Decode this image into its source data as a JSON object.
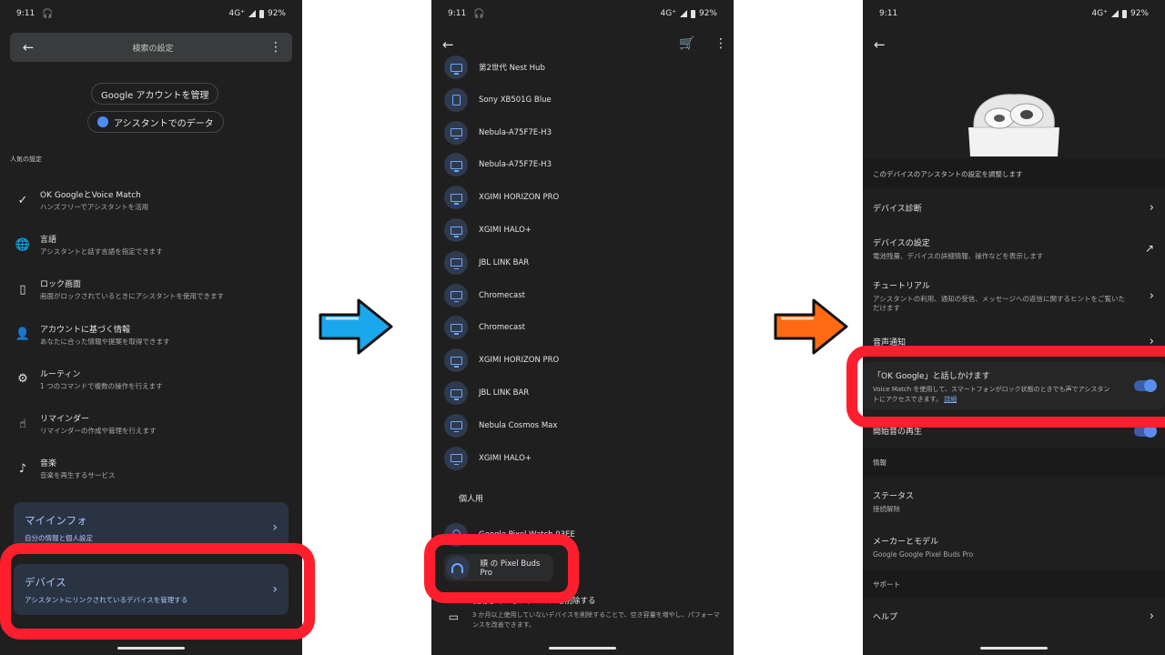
{
  "status": {
    "time": "9:11",
    "network": "4G⁺",
    "battery": "92%"
  },
  "screen1": {
    "title": "検索の設定",
    "chip_account": "Google アカウントを管理",
    "chip_data": "アシスタントでのデータ",
    "section_popular": "人気の設定",
    "items": [
      {
        "title": "OK GoogleとVoice Match",
        "subtitle": "ハンズフリーでアシスタントを活用",
        "icon": "voice-check-icon"
      },
      {
        "title": "言語",
        "subtitle": "アシスタントと話す言語を指定できます",
        "icon": "globe-icon"
      },
      {
        "title": "ロック画面",
        "subtitle": "画面がロックされているときにアシスタントを使用できます",
        "icon": "phone-lock-icon"
      },
      {
        "title": "アカウントに基づく情報",
        "subtitle": "あなたに合った情報や提案を取得できます",
        "icon": "person-check-icon"
      },
      {
        "title": "ルーティン",
        "subtitle": "1 つのコマンドで複数の操作を行えます",
        "icon": "routine-icon"
      },
      {
        "title": "リマインダー",
        "subtitle": "リマインダーの作成や管理を行えます",
        "icon": "reminder-hand-icon"
      },
      {
        "title": "音楽",
        "subtitle": "音楽を再生するサービス",
        "icon": "music-note-icon"
      }
    ],
    "card_myinfo": {
      "title": "マイインフォ",
      "subtitle": "自分の情報と個人設定"
    },
    "card_devices": {
      "title": "デバイス",
      "subtitle": "アシスタントにリンクされているデバイスを管理する"
    }
  },
  "screen2": {
    "devices": [
      {
        "name": "第2世代 Nest Hub",
        "type": "tv"
      },
      {
        "name": "Sony XB501G Blue",
        "type": "speaker"
      },
      {
        "name": "Nebula-A75F7E-H3",
        "type": "tv"
      },
      {
        "name": "Nebula-A75F7E-H3",
        "type": "tv"
      },
      {
        "name": "XGIMI HORIZON PRO",
        "type": "tv"
      },
      {
        "name": "XGIMI HALO+",
        "type": "tv"
      },
      {
        "name": "JBL LINK BAR",
        "type": "tv"
      },
      {
        "name": "Chromecast",
        "type": "tv"
      },
      {
        "name": "Chromecast",
        "type": "tv"
      },
      {
        "name": "XGIMI HORIZON PRO",
        "type": "tv"
      },
      {
        "name": "JBL LINK BAR",
        "type": "tv"
      },
      {
        "name": "Nebula Cosmos Max",
        "type": "tv"
      },
      {
        "name": "XGIMI HALO+",
        "type": "tv"
      }
    ],
    "section_personal": "個人用",
    "watch": "Google Pixel Watch 03EE",
    "buds": "順 の Pixel Buds Pro",
    "remove_title": "使用していないデバイスを削除する",
    "remove_desc": "3 か月以上使用していないデバイスを削除することで、空き容量を増やし、パフォーマンスを改善できます。"
  },
  "screen3": {
    "header_desc": "このデバイスのアシスタントの設定を調整します",
    "diag": "デバイス診断",
    "device_settings": {
      "title": "デバイスの設定",
      "subtitle": "電池残量、デバイスの詳細情報、操作などを表示します"
    },
    "tutorial": {
      "title": "チュートリアル",
      "subtitle": "アシスタントの利用、通知の受信、メッセージへの返信に関するヒントをご覧いただけます"
    },
    "voice_notify": "音声通知",
    "okgoogle": {
      "title": "「OK Google」と話しかけます",
      "subtitle": "Voice Match を使用して、スマートフォンがロック状態のときでも声でアシスタントにアクセスできます。",
      "link": "詳細"
    },
    "start_sound": "開始音の再生",
    "section_info": "情報",
    "status": {
      "title": "ステータス",
      "subtitle": "接続解除"
    },
    "maker": {
      "title": "メーカーとモデル",
      "subtitle": "Google Google Pixel Buds Pro"
    },
    "section_support": "サポート",
    "help": "ヘルプ"
  },
  "colors": {
    "highlight": "#ff1e2d",
    "arrow_blue": "#1aa7ec",
    "arrow_orange": "#ff6a13",
    "accent": "#a8c7fa"
  }
}
